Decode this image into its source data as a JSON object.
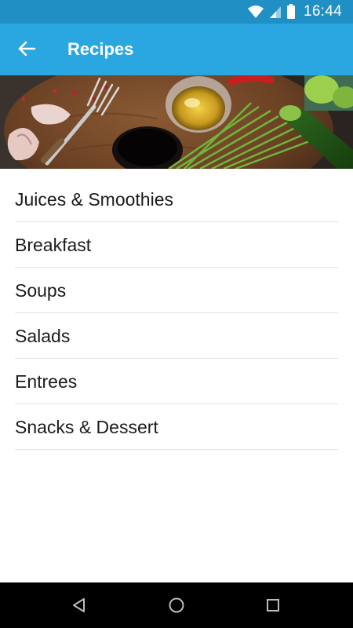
{
  "status_bar": {
    "time": "16:44",
    "icons": [
      "wifi-icon",
      "cell-signal-icon",
      "battery-icon"
    ]
  },
  "app_bar": {
    "title": "Recipes",
    "back_icon": "arrow-left-icon"
  },
  "colors": {
    "status_bar": "#1f8fc4",
    "app_bar": "#2aa7e1",
    "divider": "#e3e3e3",
    "nav_bar": "#000000"
  },
  "hero": {
    "image": "food-ingredients-banner"
  },
  "categories": [
    {
      "label": "Juices & Smoothies"
    },
    {
      "label": "Breakfast"
    },
    {
      "label": "Soups"
    },
    {
      "label": "Salads"
    },
    {
      "label": "Entrees"
    },
    {
      "label": "Snacks & Dessert"
    }
  ],
  "nav_bar": {
    "buttons": [
      "back-triangle-icon",
      "home-circle-icon",
      "recents-square-icon"
    ]
  }
}
